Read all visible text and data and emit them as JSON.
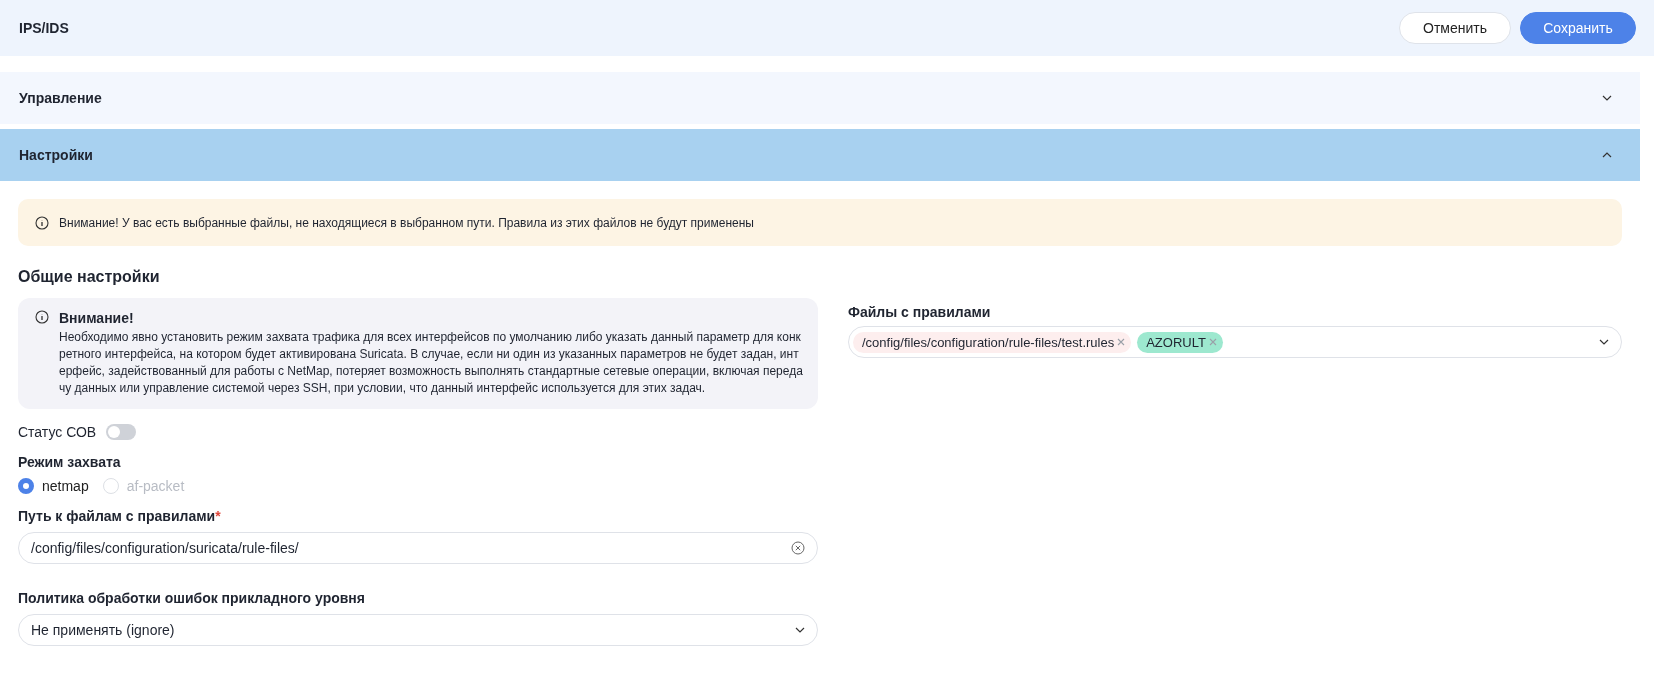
{
  "header": {
    "title": "IPS/IDS",
    "buttons": [
      {
        "label": "Отменить",
        "kind": "secondary"
      },
      {
        "label": "Сохранить",
        "kind": "primary"
      }
    ]
  },
  "sections": [
    {
      "title": "Управление",
      "expanded": false
    },
    {
      "title": "Настройки",
      "expanded": true
    }
  ],
  "warning": "Внимание! У вас есть выбранные файлы, не находящиеся в выбранном пути. Правила из этих файлов не будут применены",
  "general": {
    "title": "Общие настройки",
    "notice": {
      "title": "Внимание!",
      "text": "Необходимо явно установить режим захвата трафика для всех интерфейсов по умолчанию либо указать данный параметр для конкретного интерфейса, на котором будет активирована Suricata. В случае, если ни один из указанных параметров не будет задан, интерфейс, задействованный для работы с NetMap, потеряет возможность выполнять стандартные сетевые операции, включая передачу данных или управление системой через SSH, при условии, что данный интерфейс используется для этих задач."
    },
    "status": {
      "label": "Статус СОВ",
      "on": false
    },
    "capture": {
      "label": "Режим захвата",
      "options": [
        {
          "label": "netmap",
          "selected": true,
          "disabled": false
        },
        {
          "label": "af-packet",
          "selected": false,
          "disabled": true
        }
      ]
    },
    "path": {
      "label": "Путь к файлам с правилами",
      "required": "*",
      "value": "/config/files/configuration/suricata/rule-files/"
    },
    "policy": {
      "label": "Политика обработки ошибок прикладного уровня",
      "value": "Не применять (ignore)"
    }
  },
  "rules": {
    "label": "Файлы с правилами",
    "tags": [
      {
        "label": "/config/files/configuration/rule-files/test.rules",
        "color": "#fdeeee"
      },
      {
        "label": "AZORULT",
        "color": "#9de8cf"
      }
    ]
  }
}
